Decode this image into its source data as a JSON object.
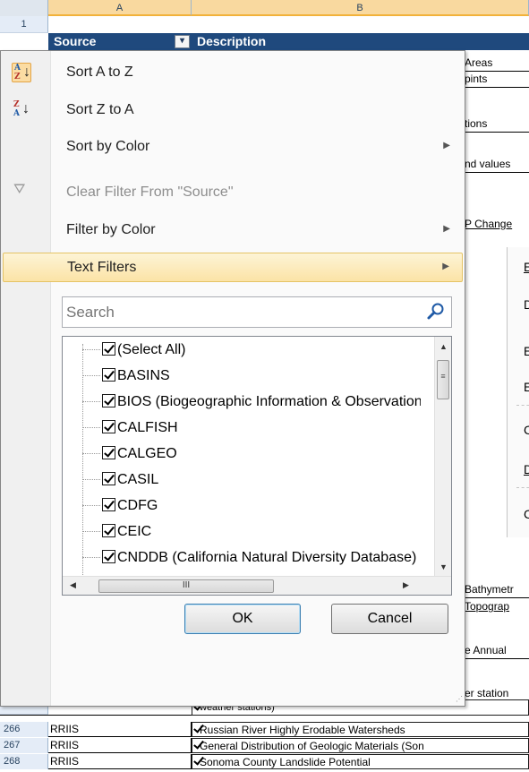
{
  "spreadsheet": {
    "columns": [
      "A",
      "B"
    ],
    "header_row_number": "1",
    "header": {
      "source": "Source",
      "description": "Description"
    },
    "visible_b_fragments": [
      "Areas",
      "pints",
      "tions",
      "nd values",
      "P Change",
      "Bathymetr",
      "Topograp",
      "e Annual",
      "er station"
    ],
    "bottom_rows": [
      {
        "row": "266",
        "source": "RRIIS",
        "description": "Russian River Highly Erodable Watersheds"
      },
      {
        "row": "267",
        "source": "RRIIS",
        "description": "General Distribution of Geologic Materials (Son"
      },
      {
        "row": "268",
        "source": "RRIIS",
        "description": "Sonoma County Landslide Potential"
      }
    ],
    "partial_cell_text": "weather stations)"
  },
  "submenu_fragments": [
    "E",
    "D",
    "E",
    "E",
    "C",
    "D",
    "C"
  ],
  "menu": {
    "sort_az": "Sort A to Z",
    "sort_za": "Sort Z to A",
    "sort_by_color": "Sort by Color",
    "clear_filter": "Clear Filter From \"Source\"",
    "filter_by_color": "Filter by Color",
    "text_filters": "Text Filters"
  },
  "search": {
    "placeholder": "Search"
  },
  "filter_list": [
    "(Select All)",
    "BASINS",
    "BIOS (Biogeographic Information & Observation System)",
    "CALFISH",
    "CALGEO",
    "CASIL",
    "CDFG",
    "CEIC",
    "CNDDB (California Natural Diversity Database)"
  ],
  "buttons": {
    "ok": "OK",
    "cancel": "Cancel"
  },
  "icons": {
    "filter_dropdown": "filter-sort-ascending-icon",
    "sort_az": "sort-az-icon",
    "sort_za": "sort-za-icon",
    "clear_filter": "clear-filter-icon",
    "search": "magnifier-icon",
    "submenu": "triangle-right-icon"
  },
  "colors": {
    "header_fill": "#1f497d",
    "menu_bg": "#fafafa",
    "highlight": "#fbe3a6",
    "column_header_selected": "#f9d99f"
  }
}
